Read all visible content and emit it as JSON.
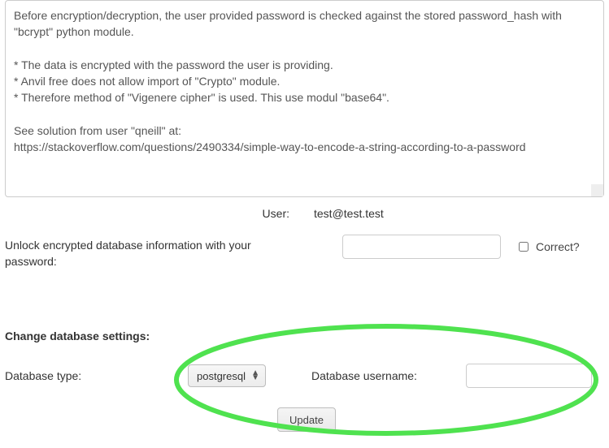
{
  "info_text": "Before encryption/decryption, the user provided password is checked against the stored password_hash with \"bcrypt\" python module.\n\n* The data is encrypted with the password the user is providing.\n* Anvil free does not allow import of \"Crypto\" module.\n* Therefore method of \"Vigenere cipher\" is used. This use modul \"base64\".\n\nSee solution from user \"qneill\" at:\nhttps://stackoverflow.com/questions/2490334/simple-way-to-encode-a-string-according-to-a-password",
  "user": {
    "label": "User:",
    "value": "test@test.test"
  },
  "unlock": {
    "label": "Unlock encrypted database information with your password:",
    "password_value": "",
    "correct_label": "Correct?",
    "correct_checked": false
  },
  "section_heading": "Change database settings:",
  "db": {
    "type_label": "Database type:",
    "type_selected": "postgresql",
    "username_label": "Database username:",
    "username_value": ""
  },
  "buttons": {
    "update": "Update"
  }
}
